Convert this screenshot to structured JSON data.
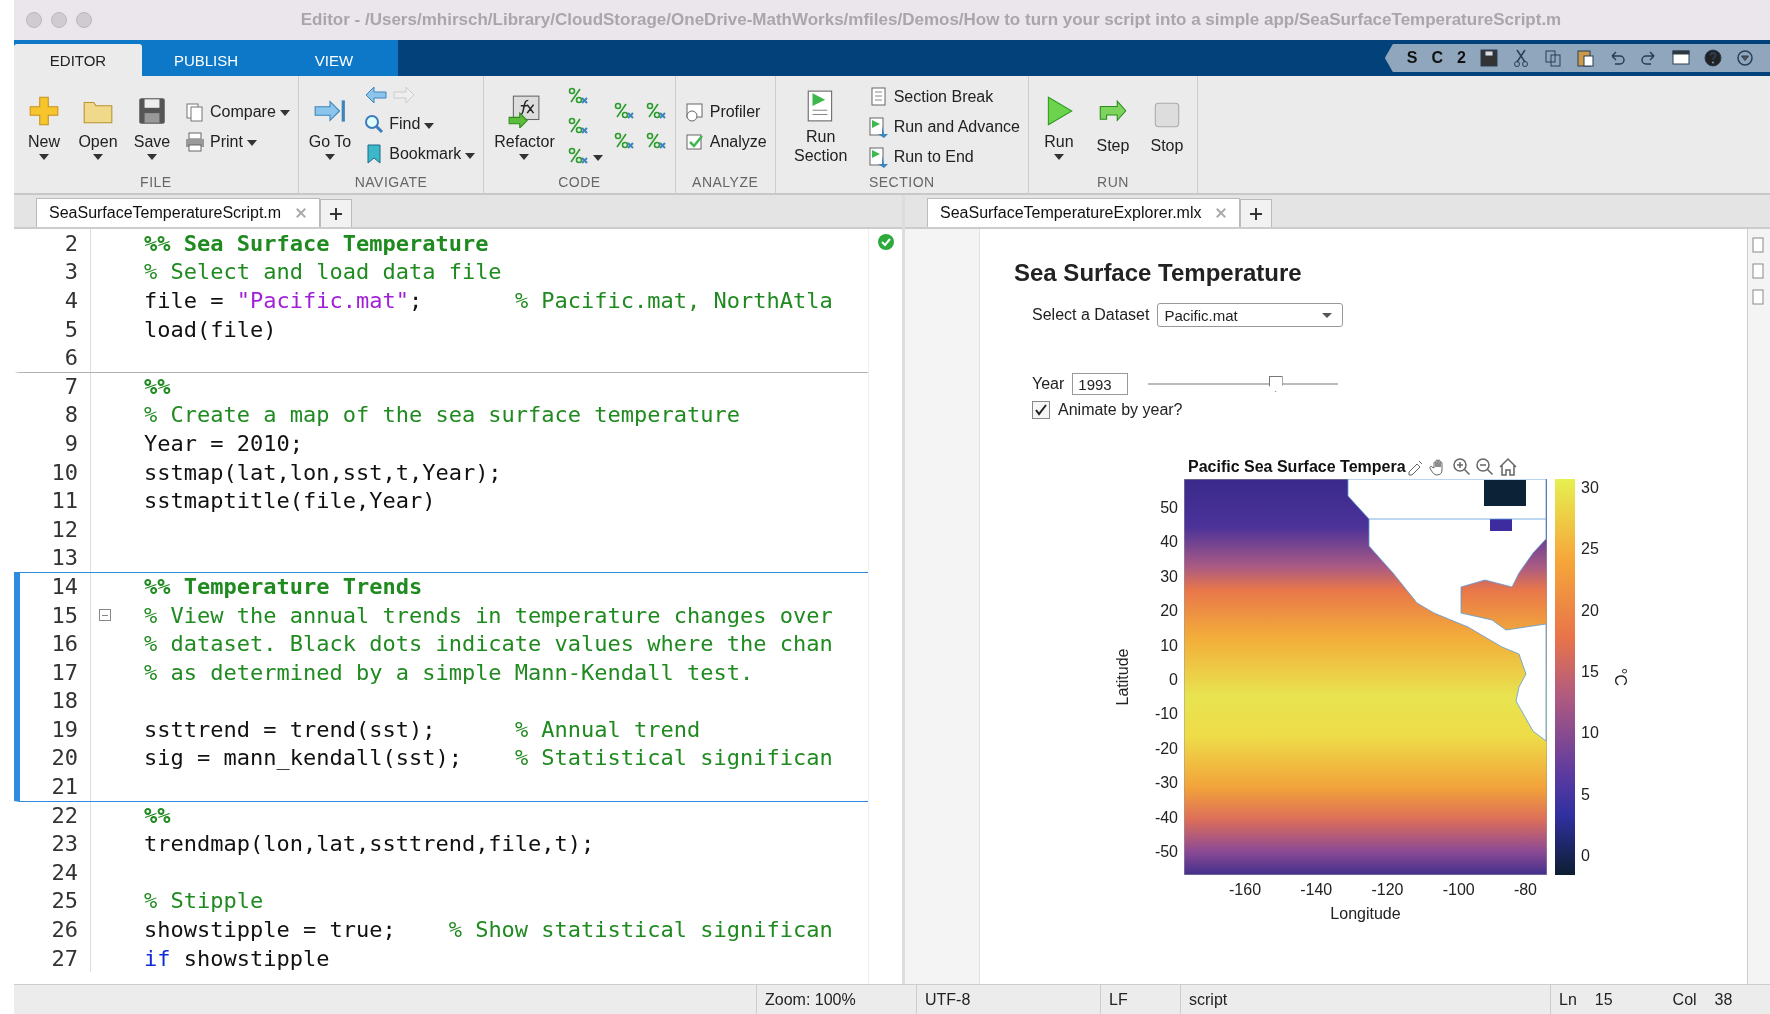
{
  "window": {
    "title": "Editor - /Users/mhirsch/Library/CloudStorage/OneDrive-MathWorks/mfiles/Demos/How to turn your script into a simple app/SeaSurfaceTemperatureScript.m"
  },
  "ribbon_tabs": [
    {
      "label": "EDITOR",
      "selected": true
    },
    {
      "label": "PUBLISH",
      "selected": false
    },
    {
      "label": "VIEW",
      "selected": false
    }
  ],
  "quick_access": [
    "S",
    "C",
    "2"
  ],
  "toolbar_groups": [
    {
      "label": "FILE",
      "columns": [
        [
          {
            "kind": "large",
            "label": "New",
            "dropdown": true
          }
        ],
        [
          {
            "kind": "large",
            "label": "Open",
            "dropdown": true
          }
        ],
        [
          {
            "kind": "large",
            "label": "Save",
            "dropdown": true
          }
        ],
        [
          {
            "kind": "small",
            "label": "Compare",
            "dropdown": true
          },
          {
            "kind": "small",
            "label": "Print",
            "dropdown": true
          }
        ]
      ]
    },
    {
      "label": "NAVIGATE",
      "columns": [
        [
          {
            "kind": "large",
            "label": "Go To",
            "dropdown": true
          }
        ],
        [
          {
            "kind": "arrows",
            "buttons": [
              {
                "disabled": false
              },
              {
                "disabled": true
              }
            ]
          },
          {
            "kind": "small",
            "label": "Find",
            "dropdown": true
          },
          {
            "kind": "small",
            "label": "Bookmark",
            "dropdown": true
          }
        ]
      ]
    },
    {
      "label": "CODE",
      "columns": [
        [
          {
            "kind": "large",
            "label": "Refactor",
            "dropdown": true
          }
        ],
        [
          {
            "kind": "icon",
            "dropdown": false
          },
          {
            "kind": "icon",
            "dropdown": false
          },
          {
            "kind": "icon",
            "dropdown": true
          }
        ],
        [
          {
            "kind": "icon",
            "dropdown": false
          },
          {
            "kind": "icon",
            "dropdown": false
          }
        ],
        [
          {
            "kind": "icon",
            "dropdown": false
          },
          {
            "kind": "icon",
            "dropdown": false
          }
        ]
      ]
    },
    {
      "label": "ANALYZE",
      "columns": [
        [
          {
            "kind": "small",
            "label": "Profiler",
            "dropdown": false
          },
          {
            "kind": "small",
            "label": "Analyze",
            "dropdown": false
          }
        ]
      ]
    },
    {
      "label": "SECTION",
      "columns": [
        [
          {
            "kind": "large",
            "label": "Run Section",
            "dropdown": false
          }
        ],
        [
          {
            "kind": "small",
            "label": "Section Break",
            "dropdown": false
          },
          {
            "kind": "small",
            "label": "Run and Advance",
            "dropdown": false
          },
          {
            "kind": "small",
            "label": "Run to End",
            "dropdown": false
          }
        ]
      ]
    },
    {
      "label": "RUN",
      "columns": [
        [
          {
            "kind": "large",
            "label": "Run",
            "dropdown": true
          }
        ],
        [
          {
            "kind": "large",
            "label": "Step",
            "dropdown": false
          }
        ],
        [
          {
            "kind": "large",
            "label": "Stop",
            "dropdown": false
          }
        ]
      ]
    }
  ],
  "script_editor": {
    "tab": {
      "label": "SeaSurfaceTemperatureScript.m",
      "selected": true
    },
    "lines": [
      {
        "number": "2",
        "section_start": false,
        "current_section": false,
        "segments": [
          {
            "kind": "section",
            "text": "%% Sea Surface Temperature"
          }
        ]
      },
      {
        "number": "3",
        "section_start": false,
        "current_section": false,
        "segments": [
          {
            "kind": "comment",
            "text": "% Select and load data file"
          }
        ]
      },
      {
        "number": "4",
        "section_start": false,
        "current_section": false,
        "segments": [
          {
            "kind": "code",
            "text": "file = "
          },
          {
            "kind": "string",
            "text": "\"Pacific.mat\""
          },
          {
            "kind": "code",
            "text": ";       "
          },
          {
            "kind": "comment",
            "text": "% Pacific.mat, NorthAtla"
          }
        ]
      },
      {
        "number": "5",
        "section_start": false,
        "current_section": false,
        "segments": [
          {
            "kind": "code",
            "text": "load(file)"
          }
        ]
      },
      {
        "number": "6",
        "section_start": false,
        "current_section": false
      },
      {
        "number": "7",
        "section_start": true,
        "current_section": false,
        "segments": [
          {
            "kind": "section",
            "text": "%%"
          }
        ]
      },
      {
        "number": "8",
        "section_start": false,
        "current_section": false,
        "segments": [
          {
            "kind": "comment",
            "text": "% Create a map of the sea surface temperature"
          }
        ]
      },
      {
        "number": "9",
        "section_start": false,
        "current_section": false,
        "segments": [
          {
            "kind": "code",
            "text": "Year = 2010;"
          }
        ]
      },
      {
        "number": "10",
        "section_start": false,
        "current_section": false,
        "segments": [
          {
            "kind": "code",
            "text": "sstmap(lat,lon,sst,t,Year);"
          }
        ]
      },
      {
        "number": "11",
        "section_start": false,
        "current_section": false,
        "segments": [
          {
            "kind": "code",
            "text": "sstmaptitle(file,Year)"
          }
        ]
      },
      {
        "number": "12",
        "section_start": false,
        "current_section": false
      },
      {
        "number": "13",
        "section_start": false,
        "current_section": false
      },
      {
        "number": "14",
        "section_start": true,
        "current_section": true,
        "segments": [
          {
            "kind": "section",
            "text": "%% Temperature Trends"
          }
        ]
      },
      {
        "number": "15",
        "section_start": false,
        "current_section": true,
        "fold": true,
        "segments": [
          {
            "kind": "comment",
            "text": "% View the annual trends in temperature changes over"
          }
        ]
      },
      {
        "number": "16",
        "section_start": false,
        "current_section": true,
        "segments": [
          {
            "kind": "comment",
            "text": "% dataset. Black dots indicate values where the chan"
          }
        ]
      },
      {
        "number": "17",
        "section_start": false,
        "current_section": true,
        "segments": [
          {
            "kind": "comment",
            "text": "% as determined by a simple Mann-Kendall test."
          }
        ]
      },
      {
        "number": "18",
        "section_start": false,
        "current_section": true
      },
      {
        "number": "19",
        "section_start": false,
        "current_section": true,
        "segments": [
          {
            "kind": "code",
            "text": "ssttrend = trend(sst);      "
          },
          {
            "kind": "comment",
            "text": "% Annual trend"
          }
        ]
      },
      {
        "number": "20",
        "section_start": false,
        "current_section": true,
        "segments": [
          {
            "kind": "code",
            "text": "sig = mann_kendall(sst);    "
          },
          {
            "kind": "comment",
            "text": "% Statistical significan"
          }
        ]
      },
      {
        "number": "21",
        "section_start": false,
        "current_section": true
      },
      {
        "number": "22",
        "section_start": true,
        "current_section": false,
        "segments": [
          {
            "kind": "section",
            "text": "%%"
          }
        ]
      },
      {
        "number": "23",
        "section_start": false,
        "current_section": false,
        "segments": [
          {
            "kind": "code",
            "text": "trendmap(lon,lat,ssttrend,file,t);"
          }
        ]
      },
      {
        "number": "24",
        "section_start": false,
        "current_section": false
      },
      {
        "number": "25",
        "section_start": false,
        "current_section": false,
        "segments": [
          {
            "kind": "comment",
            "text": "% Stipple"
          }
        ]
      },
      {
        "number": "26",
        "section_start": false,
        "current_section": false,
        "segments": [
          {
            "kind": "code",
            "text": "showstipple = true;    "
          },
          {
            "kind": "comment",
            "text": "% Show statistical significan"
          }
        ]
      },
      {
        "number": "27",
        "section_start": false,
        "current_section": false,
        "segments": [
          {
            "kind": "keyword",
            "text": "if"
          },
          {
            "kind": "code",
            "text": " showstipple"
          }
        ]
      }
    ]
  },
  "live_editor": {
    "tab": {
      "label": "SeaSurfaceTemperatureExplorer.mlx",
      "selected": true
    },
    "heading": "Sea Surface Temperature",
    "dataset": {
      "label": "Select a Dataset",
      "value": "Pacific.mat"
    },
    "year": {
      "label": "Year",
      "value": "1993",
      "level": 0.67
    },
    "animate": {
      "label": "Animate by year?",
      "checked": true
    },
    "figure": {
      "title": "Pacific Sea Surface Tempera",
      "ylabel": "Latitude",
      "xlabel": "Longitude",
      "colorbar_label": "°C",
      "yticks": [
        "50",
        "40",
        "30",
        "20",
        "10",
        "0",
        "-10",
        "-20",
        "-30",
        "-40",
        "-50"
      ],
      "xticks": [
        "-160",
        "-140",
        "-120",
        "-100",
        "-80"
      ],
      "colorbar_ticks": [
        "30",
        "25",
        "20",
        "15",
        "10",
        "5",
        "0"
      ]
    }
  },
  "status_bar": {
    "zoom": "Zoom: 100%",
    "encoding": "UTF-8",
    "line_ending": "LF",
    "file_type": "script",
    "ln_label": "Ln",
    "ln": "15",
    "col_label": "Col",
    "col": "38"
  }
}
